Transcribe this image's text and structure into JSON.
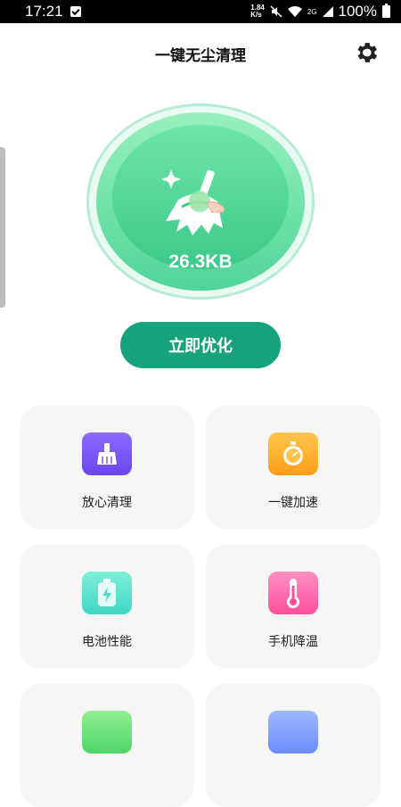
{
  "status_bar": {
    "time": "17:21",
    "net_speed_value": "1.84",
    "net_speed_unit": "K/s",
    "network": "2G",
    "battery": "100%"
  },
  "header": {
    "title": "一键无尘清理"
  },
  "cleaner": {
    "size": "26.3KB",
    "button_label": "立即优化"
  },
  "features": [
    {
      "label": "放心清理",
      "icon": "broom-icon",
      "color": "#7a57f7"
    },
    {
      "label": "一键加速",
      "icon": "stopwatch-icon",
      "color": "#ffb02e"
    },
    {
      "label": "电池性能",
      "icon": "battery-icon",
      "color": "#4fdcc8"
    },
    {
      "label": "手机降温",
      "icon": "thermometer-icon",
      "color": "#ff5ea8"
    }
  ],
  "colors": {
    "accent": "#16a27a",
    "circle_green": "#4fd49a"
  }
}
